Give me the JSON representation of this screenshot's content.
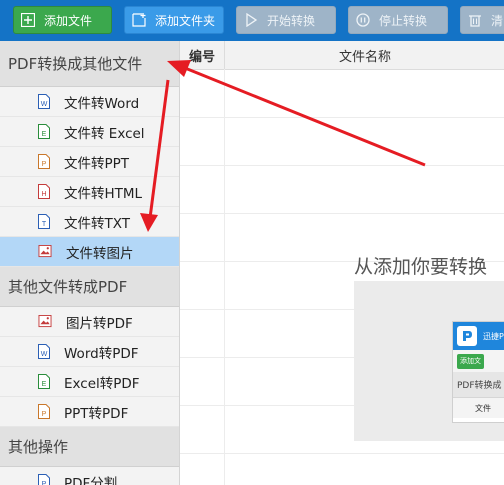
{
  "toolbar": {
    "buttons": [
      {
        "label": "添加文件",
        "icon": "add-file-icon"
      },
      {
        "label": "添加文件夹",
        "icon": "add-folder-icon"
      },
      {
        "label": "开始转换",
        "icon": "play-icon"
      },
      {
        "label": "停止转换",
        "icon": "stop-icon"
      },
      {
        "label": "清",
        "icon": "trash-icon"
      }
    ]
  },
  "sidebar": {
    "sections": [
      {
        "title": "PDF转换成其他文件",
        "items": [
          {
            "label": "文件转Word",
            "icon": "word-file-icon",
            "color": "#2b5fb5"
          },
          {
            "label": "文件转 Excel",
            "icon": "excel-file-icon",
            "color": "#2a8d3b"
          },
          {
            "label": "文件转PPT",
            "icon": "ppt-file-icon",
            "color": "#c9772a"
          },
          {
            "label": "文件转HTML",
            "icon": "html-file-icon",
            "color": "#c43b3b"
          },
          {
            "label": "文件转TXT",
            "icon": "txt-file-icon",
            "color": "#2b5fb5"
          },
          {
            "label": "文件转图片",
            "icon": "image-file-icon",
            "color": "#c43b3b",
            "active": true
          }
        ]
      },
      {
        "title": "其他文件转成PDF",
        "items": [
          {
            "label": "图片转PDF",
            "icon": "image-file-icon",
            "color": "#c43b3b"
          },
          {
            "label": "Word转PDF",
            "icon": "word-file-icon",
            "color": "#2b5fb5"
          },
          {
            "label": "Excel转PDF",
            "icon": "excel-file-icon",
            "color": "#2a8d3b"
          },
          {
            "label": "PPT转PDF",
            "icon": "ppt-file-icon",
            "color": "#c9772a"
          }
        ]
      },
      {
        "title": "其他操作",
        "items": [
          {
            "label": "PDF分割",
            "icon": "pdf-file-icon",
            "color": "#2b5fb5"
          }
        ]
      }
    ]
  },
  "table": {
    "headers": [
      "编号",
      "文件名称"
    ]
  },
  "main": {
    "hint": "从添加你要转换"
  },
  "preview": {
    "app_name": "迅捷P",
    "add_button": "添加文",
    "section": "PDF转换成",
    "item": "文件"
  },
  "colors": {
    "toolbar_bg": "#1473c6",
    "active_item": "#b3d7f7",
    "arrow": "#e51c23"
  }
}
